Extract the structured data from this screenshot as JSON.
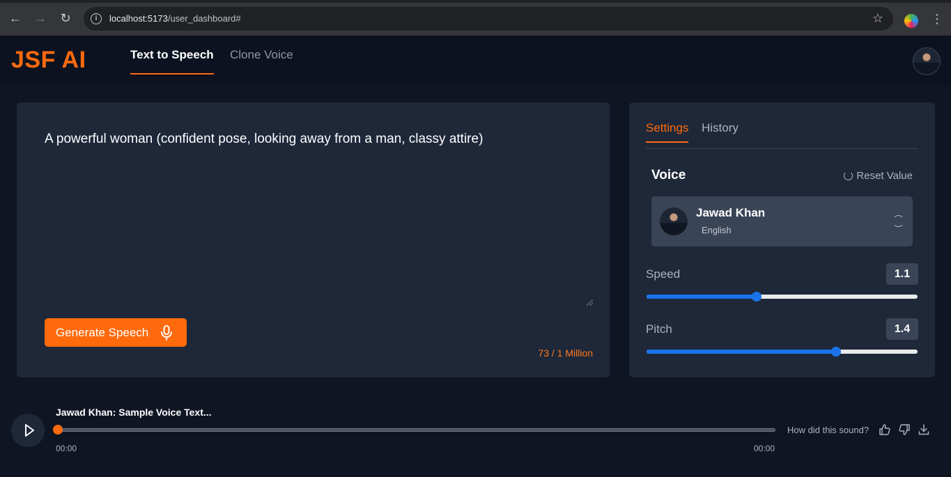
{
  "browser": {
    "url_host": "localhost:5173",
    "url_path": "/user_dashboard#"
  },
  "app": {
    "logo": "JSF AI",
    "nav_tabs": [
      {
        "label": "Text to Speech",
        "active": true
      },
      {
        "label": "Clone Voice",
        "active": false
      }
    ]
  },
  "editor": {
    "text": "A powerful woman (confident pose, looking away from a man, classy attire)",
    "generate_label": "Generate Speech",
    "char_count": "73 / 1 Million"
  },
  "settings": {
    "tabs": [
      {
        "label": "Settings",
        "active": true
      },
      {
        "label": "History",
        "active": false
      }
    ],
    "voice_title": "Voice",
    "reset_label": "Reset Value",
    "voice": {
      "name": "Jawad Khan",
      "language": "English"
    },
    "speed": {
      "label": "Speed",
      "value": "1.1",
      "fraction": 0.405
    },
    "pitch": {
      "label": "Pitch",
      "value": "1.4",
      "fraction": 0.698
    }
  },
  "player": {
    "title": "Jawad Khan: Sample Voice Text...",
    "current_time": "00:00",
    "duration": "00:00",
    "progress_fraction": 0,
    "feedback_prompt": "How did this sound?"
  },
  "colors": {
    "accent": "#ff6a0d",
    "slider": "#1a73e8",
    "panel": "#1e2839",
    "background": "#0f1523"
  }
}
